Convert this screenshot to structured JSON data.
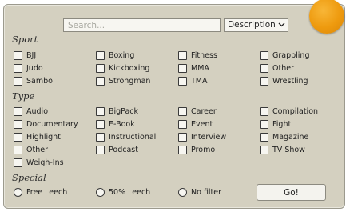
{
  "search": {
    "placeholder": "Search...",
    "value": ""
  },
  "search_field": {
    "selected": "Description"
  },
  "sections": {
    "sport": "Sport",
    "type": "Type",
    "special": "Special"
  },
  "sport": [
    "BJJ",
    "Boxing",
    "Fitness",
    "Grappling",
    "Judo",
    "Kickboxing",
    "MMA",
    "Other",
    "Sambo",
    "Strongman",
    "TMA",
    "Wrestling"
  ],
  "type": [
    "Audio",
    "BigPack",
    "Career",
    "Compilation",
    "Documentary",
    "E-Book",
    "Event",
    "Fight",
    "Highlight",
    "Instructional",
    "Interview",
    "Magazine",
    "Other",
    "Podcast",
    "Promo",
    "TV Show",
    "Weigh-Ins"
  ],
  "special": [
    "Free Leech",
    "50% Leech",
    "No filter"
  ],
  "go_label": "Go!",
  "colors": {
    "panel": "#d4d0c0",
    "orb": "#ee9a0e"
  },
  "icons": {
    "select_arrow": "chevron-down-icon",
    "corner_orb": "orange-orb-icon"
  }
}
